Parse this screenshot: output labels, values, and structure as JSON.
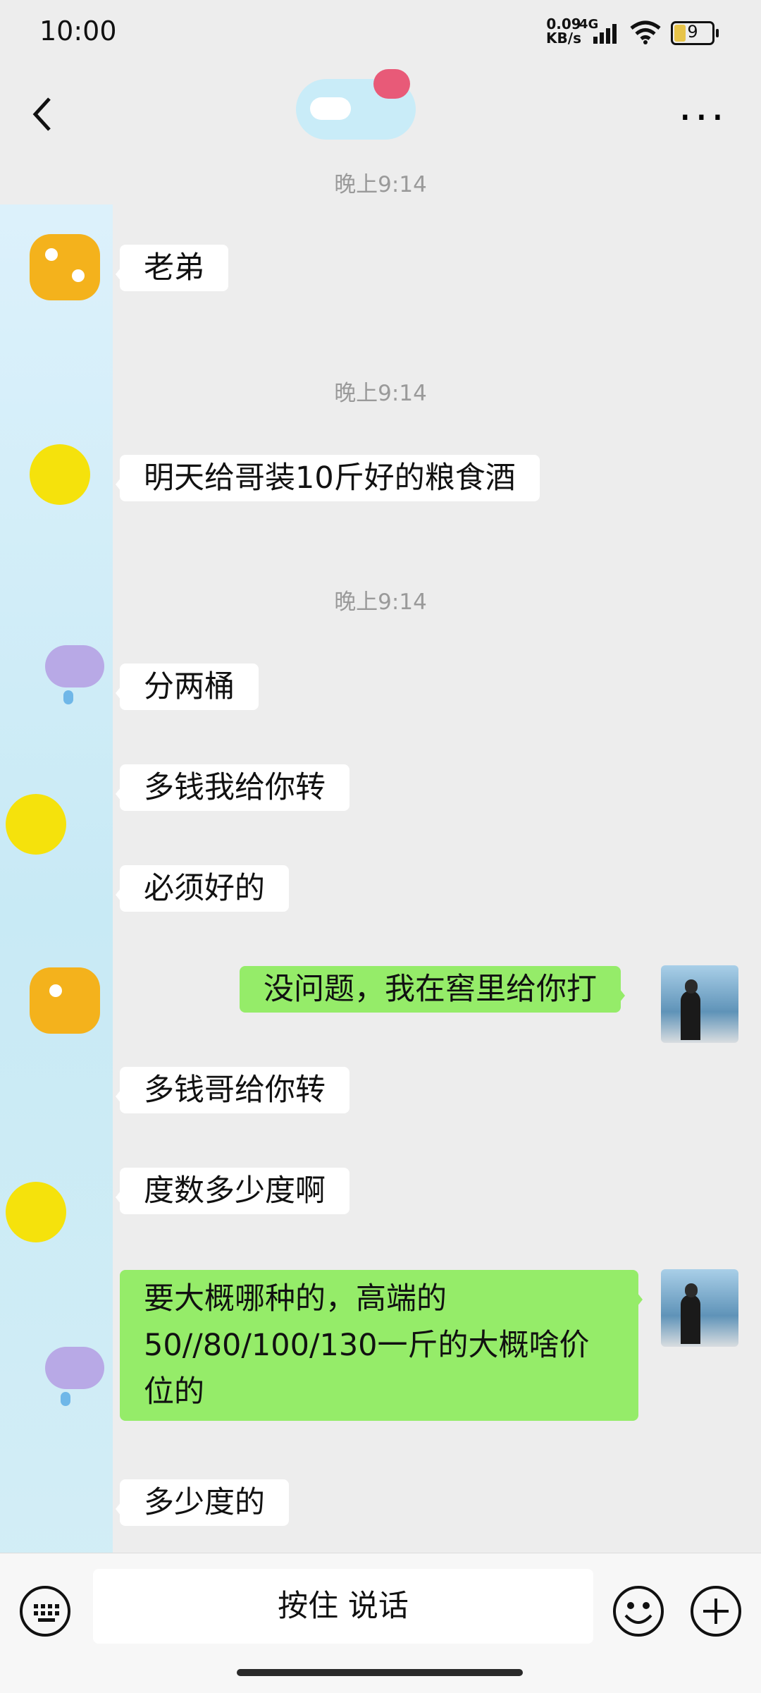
{
  "status_bar": {
    "time": "10:00",
    "net_speed_value": "0.09",
    "net_speed_unit": "KB/s",
    "network_type": "4G",
    "battery": "9"
  },
  "header": {
    "back_icon": "chevron-left-icon",
    "more_icon": "more-dots-icon"
  },
  "messages": [
    {
      "timestamp": "晚上9:14"
    },
    {
      "from": "contact",
      "text": "老弟"
    },
    {
      "timestamp": "晚上9:14"
    },
    {
      "from": "contact",
      "text": "明天给哥装10斤好的粮食酒"
    },
    {
      "timestamp": "晚上9:14"
    },
    {
      "from": "contact",
      "text": "分两桶"
    },
    {
      "from": "contact",
      "text": "多钱我给你转"
    },
    {
      "from": "contact",
      "text": "必须好的"
    },
    {
      "from": "me",
      "text": "没问题，我在窖里给你打"
    },
    {
      "from": "contact",
      "text": "多钱哥给你转"
    },
    {
      "from": "contact",
      "text": "度数多少度啊"
    },
    {
      "from": "me",
      "text": "要大概哪种的，高端的50//80/100/130一斤的大概啥价位的"
    },
    {
      "from": "contact",
      "text": "多少度的"
    }
  ],
  "input_bar": {
    "keyboard_icon": "keyboard-icon",
    "voice_label": "按住 说话",
    "emoji_icon": "emoji-icon",
    "plus_icon": "plus-icon"
  },
  "colors": {
    "background": "#ededed",
    "outgoing_bubble": "#95ec69",
    "incoming_bubble": "#ffffff"
  }
}
